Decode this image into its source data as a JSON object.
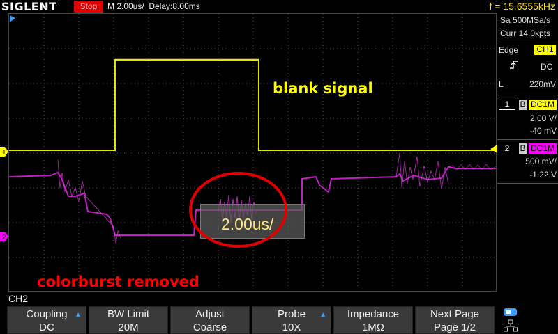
{
  "header": {
    "brand": "SIGLENT",
    "run_state": "Stop",
    "timebase": "M 2.00us/",
    "delay": "Delay:8.00ms",
    "frequency": "f = 15.6555kHz"
  },
  "acquisition": {
    "sample_rate": "Sa 500MSa/s",
    "memory_depth": "Curr 14.0kpts"
  },
  "trigger": {
    "type": "Edge",
    "source": "CH1",
    "coupling": "DC",
    "level_label": "L",
    "level": "220mV"
  },
  "channels": [
    {
      "number": "1",
      "bw_mark": "B",
      "coupling": "DC1M",
      "scale": "2.00 V/",
      "offset": "-40 mV",
      "color": "#ffff00"
    },
    {
      "number": "2",
      "bw_mark": "B",
      "coupling": "DC1M",
      "scale": "500 mV/",
      "offset": "-1.22 V",
      "color": "#ff00ff"
    }
  ],
  "markers": {
    "ch1": "1",
    "ch2": "2"
  },
  "annotations": {
    "blank": "blank signal",
    "colorburst": "colorburst removed",
    "timebase_popup": "2.00us/"
  },
  "menu": {
    "channel_label": "CH2",
    "buttons": [
      {
        "line1": "Coupling",
        "line2": "DC"
      },
      {
        "line1": "BW Limit",
        "line2": "20M"
      },
      {
        "line1": "Adjust",
        "line2": "Coarse"
      },
      {
        "line1": "Probe",
        "line2": "10X"
      },
      {
        "line1": "Impedance",
        "line2": "1MΩ"
      },
      {
        "line1": "Next Page",
        "line2": "Page 1/2"
      }
    ]
  },
  "colors": {
    "ch1": "#ffff00",
    "ch2": "#ff00ff",
    "stop": "#e00000",
    "trigger_level": "#ffe000",
    "annotation_yellow": "#ffff00",
    "annotation_red": "#ff0000",
    "menu_arrow": "#3a9cff"
  }
}
